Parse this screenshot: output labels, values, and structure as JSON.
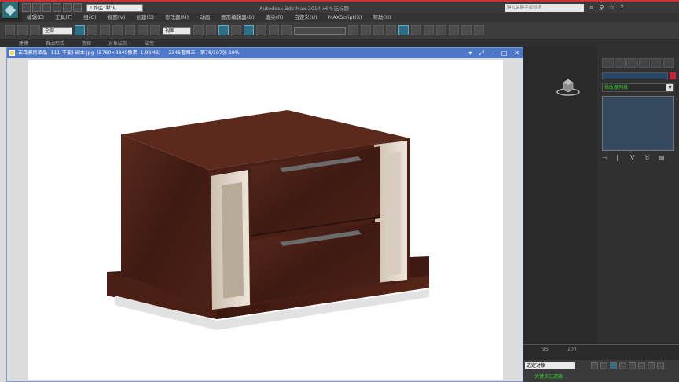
{
  "titlebar": {
    "workspace_label": "工作区: 默认",
    "window_title": "Autodesk 3ds Max  2014 x64      无标题",
    "search_placeholder": "键入关键字或短语"
  },
  "menus": [
    "编辑(E)",
    "工具(T)",
    "组(G)",
    "视图(V)",
    "创建(C)",
    "修改器(M)",
    "动画",
    "图形编辑器(D)",
    "渲染(R)",
    "自定义(U)",
    "MAXScript(X)",
    "帮助(H)"
  ],
  "toolbar": {
    "selection_filter": "全部",
    "reference_coord": "视图",
    "named_selection": ""
  },
  "ribbon_tabs": [
    "建模",
    "自由形式",
    "选择",
    "对象绘制",
    "填充"
  ],
  "image_viewer": {
    "title": "古森雅房单品--111(不要) 副本.jpg（5760×3840像素, 1.96MB） - 2345看图王 - 第78/107张 19%"
  },
  "command_panel": {
    "modifier_list_label": "修改器列表"
  },
  "timeline": {
    "ticks": [
      "95",
      "100"
    ]
  },
  "status": {
    "selection_dropdown": "选定对象",
    "key_filter_label": "关键点过滤器..."
  }
}
